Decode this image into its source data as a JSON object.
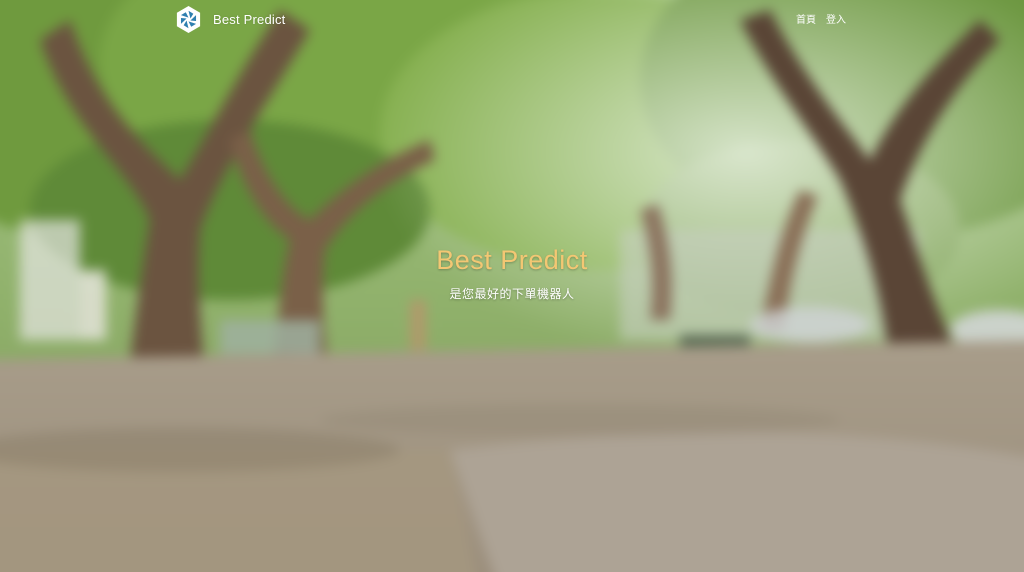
{
  "header": {
    "brand_name": "Best Predict",
    "logo_icon": "aperture-hexagon-logo-icon",
    "nav": [
      {
        "label": "首頁"
      },
      {
        "label": "登入"
      }
    ]
  },
  "hero": {
    "title": "Best Predict",
    "subtitle": "是您最好的下單機器人",
    "background_image": "blurred tree-lined park path",
    "colors": {
      "title": "#f3c773",
      "text": "#ffffff"
    }
  }
}
